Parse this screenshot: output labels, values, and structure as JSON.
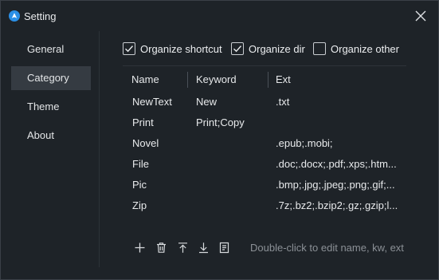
{
  "window": {
    "title": "Setting",
    "accent": "#2b8fe6"
  },
  "sidebar": {
    "items": [
      {
        "label": "General",
        "active": false
      },
      {
        "label": "Category",
        "active": true
      },
      {
        "label": "Theme",
        "active": false
      },
      {
        "label": "About",
        "active": false
      }
    ]
  },
  "options": {
    "organize_shortcut": {
      "label": "Organize shortcut",
      "checked": true
    },
    "organize_dir": {
      "label": "Organize dir",
      "checked": true
    },
    "organize_other": {
      "label": "Organize other",
      "checked": false
    }
  },
  "table": {
    "headers": {
      "name": "Name",
      "keyword": "Keyword",
      "ext": "Ext"
    },
    "rows": [
      {
        "name": "NewText",
        "keyword": "New",
        "ext": ".txt"
      },
      {
        "name": "Print",
        "keyword": "Print;Copy",
        "ext": ""
      },
      {
        "name": "Novel",
        "keyword": "",
        "ext": ".epub;.mobi;"
      },
      {
        "name": "File",
        "keyword": "",
        "ext": ".doc;.docx;.pdf;.xps;.htm..."
      },
      {
        "name": "Pic",
        "keyword": "",
        "ext": ".bmp;.jpg;.jpeg;.png;.gif;..."
      },
      {
        "name": "Zip",
        "keyword": "",
        "ext": ".7z;.bz2;.bzip2;.gz;.gzip;l..."
      }
    ]
  },
  "toolbar": {
    "icons": [
      "add-icon",
      "delete-icon",
      "move-top-icon",
      "move-down-icon",
      "edit-icon"
    ],
    "hint": "Double-click to edit name, kw, ext"
  }
}
